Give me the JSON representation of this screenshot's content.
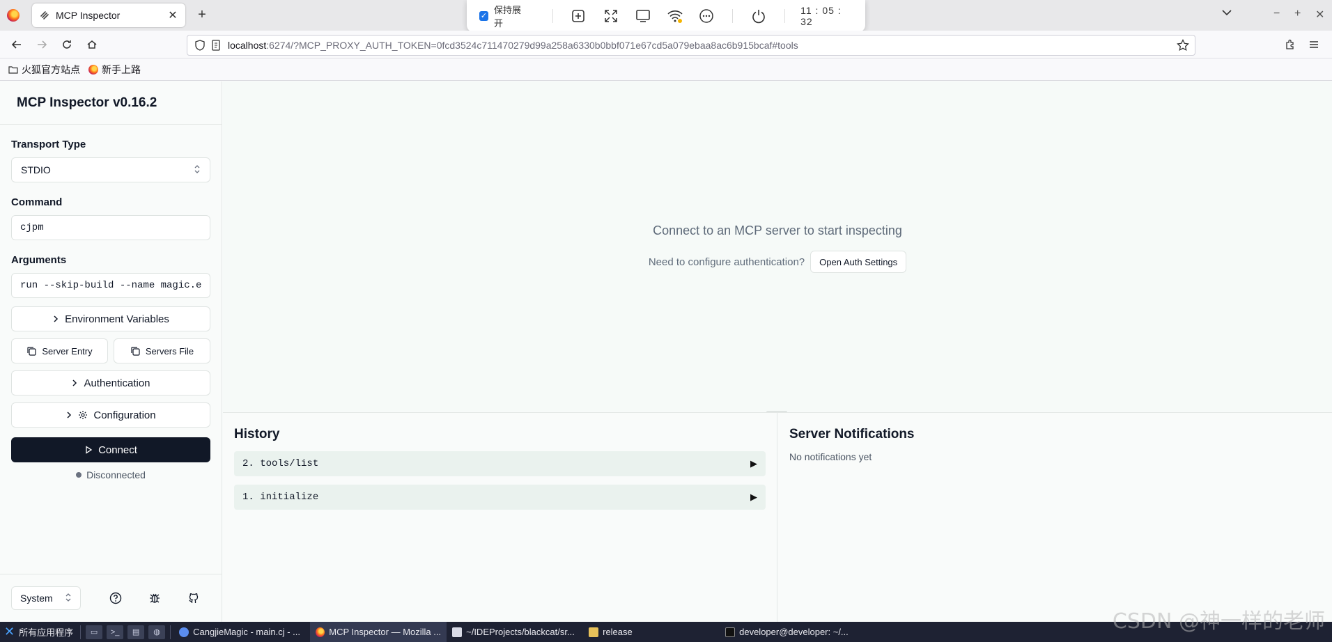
{
  "browser": {
    "tab_title": "MCP Inspector",
    "url_host": "localhost",
    "url_rest": ":6274/?MCP_PROXY_AUTH_TOKEN=0fcd3524c711470279d99a258a6330b0bbf071e67cd5a079ebaa8ac6b915bcaf#tools",
    "bookmarks": [
      "火狐官方站点",
      "新手上路"
    ]
  },
  "remote_toolbar": {
    "keep_expanded_label": "保持展开",
    "time": "11 : 05 : 32"
  },
  "sidebar": {
    "title": "MCP Inspector v0.16.2",
    "transport_label": "Transport Type",
    "transport_value": "STDIO",
    "command_label": "Command",
    "command_value": "cjpm",
    "arguments_label": "Arguments",
    "arguments_value": "run --skip-build --name magic.e",
    "env_vars_label": "Environment Variables",
    "server_entry_label": "Server Entry",
    "servers_file_label": "Servers File",
    "authentication_label": "Authentication",
    "configuration_label": "Configuration",
    "connect_label": "Connect",
    "status_text": "Disconnected",
    "theme_value": "System"
  },
  "main": {
    "empty_message": "Connect to an MCP server to start inspecting",
    "auth_prompt": "Need to configure authentication?",
    "auth_button": "Open Auth Settings"
  },
  "history": {
    "title": "History",
    "items": [
      "2. tools/list",
      "1. initialize"
    ]
  },
  "notifications": {
    "title": "Server Notifications",
    "empty": "No notifications yet"
  },
  "taskbar": {
    "start_label": "所有应用程序",
    "tasks": [
      "CangjieMagic - main.cj - ...",
      "MCP Inspector — Mozilla ...",
      "~/IDEProjects/blackcat/sr...",
      "release",
      "developer@developer: ~/..."
    ]
  },
  "watermark": "CSDN @神一样的老师"
}
